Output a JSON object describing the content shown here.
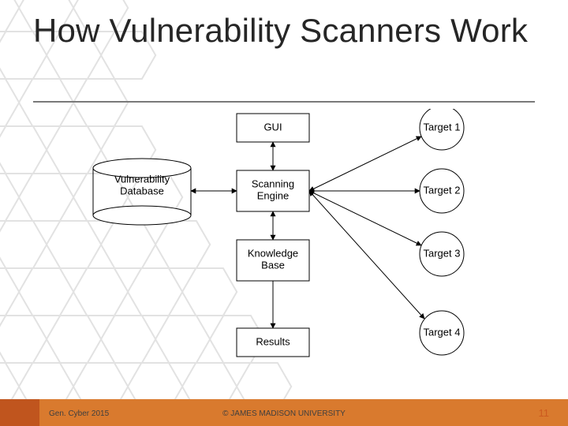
{
  "slide": {
    "title": "How Vulnerability Scanners Work",
    "footer_left": "Gen. Cyber 2015",
    "footer_center": "© JAMES MADISON UNIVERSITY",
    "page_number": "11"
  },
  "diagram": {
    "database": "Vulnerability\nDatabase",
    "gui": "GUI",
    "scanning_engine": "Scanning\nEngine",
    "knowledge_base": "Knowledge\nBase",
    "results": "Results",
    "target1": "Target 1",
    "target2": "Target 2",
    "target3": "Target 3",
    "target4": "Target 4"
  },
  "chart_data": {
    "type": "diagram",
    "nodes": [
      {
        "id": "db",
        "label": "Vulnerability Database",
        "shape": "cylinder"
      },
      {
        "id": "gui",
        "label": "GUI",
        "shape": "rect"
      },
      {
        "id": "engine",
        "label": "Scanning Engine",
        "shape": "rect"
      },
      {
        "id": "kb",
        "label": "Knowledge Base",
        "shape": "rect"
      },
      {
        "id": "results",
        "label": "Results",
        "shape": "rect"
      },
      {
        "id": "t1",
        "label": "Target 1",
        "shape": "circle"
      },
      {
        "id": "t2",
        "label": "Target 2",
        "shape": "circle"
      },
      {
        "id": "t3",
        "label": "Target 3",
        "shape": "circle"
      },
      {
        "id": "t4",
        "label": "Target 4",
        "shape": "circle"
      }
    ],
    "edges": [
      {
        "from": "db",
        "to": "engine",
        "bidirectional": true
      },
      {
        "from": "gui",
        "to": "engine",
        "bidirectional": true
      },
      {
        "from": "engine",
        "to": "kb",
        "bidirectional": true
      },
      {
        "from": "kb",
        "to": "results",
        "bidirectional": false
      },
      {
        "from": "engine",
        "to": "t1",
        "bidirectional": true
      },
      {
        "from": "engine",
        "to": "t2",
        "bidirectional": true
      },
      {
        "from": "engine",
        "to": "t3",
        "bidirectional": true
      },
      {
        "from": "engine",
        "to": "t4",
        "bidirectional": true
      }
    ]
  }
}
